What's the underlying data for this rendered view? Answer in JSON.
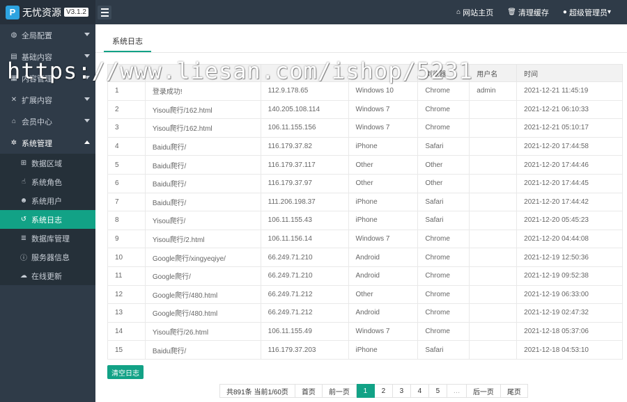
{
  "header": {
    "logo_mark": "P",
    "app_title": "无忧资源",
    "version": "V3.1.2",
    "links": [
      {
        "icon": "home-icon",
        "glyph": "⌂",
        "label": "网站主页"
      },
      {
        "icon": "trash-icon",
        "glyph": "🗑",
        "label": "清理缓存"
      },
      {
        "icon": "user-icon",
        "glyph": "●",
        "label": "超级管理员"
      }
    ],
    "user_caret": "▾"
  },
  "sidebar": {
    "items": [
      {
        "icon": "globe-icon",
        "glyph": "◍",
        "label": "全局配置"
      },
      {
        "icon": "folder-icon",
        "glyph": "▤",
        "label": "基础内容"
      },
      {
        "icon": "content-icon",
        "glyph": "▦",
        "label": "内容管理"
      },
      {
        "icon": "expand-icon",
        "glyph": "✕",
        "label": "扩展内容"
      },
      {
        "icon": "lock-icon",
        "glyph": "⌂",
        "label": "会员中心"
      },
      {
        "icon": "gear-icon",
        "glyph": "✲",
        "label": "系统管理"
      }
    ],
    "sub_items": [
      {
        "icon": "sitemap-icon",
        "glyph": "⊞",
        "label": "数据区域"
      },
      {
        "icon": "hand-icon",
        "glyph": "☝",
        "label": "系统角色"
      },
      {
        "icon": "users-icon",
        "glyph": "☻",
        "label": "系统用户"
      },
      {
        "icon": "history-icon",
        "glyph": "↺",
        "label": "系统日志"
      },
      {
        "icon": "database-icon",
        "glyph": "≣",
        "label": "数据库管理"
      },
      {
        "icon": "info-icon",
        "glyph": "ⓘ",
        "label": "服务器信息"
      },
      {
        "icon": "cloud-upload-icon",
        "glyph": "☁",
        "label": "在线更新"
      }
    ]
  },
  "main": {
    "tab": "系统日志",
    "watermark": "https://www.liesan.com/ishop/5231",
    "columns": [
      "",
      "",
      "",
      "",
      "浏览器",
      "用户名",
      "时间"
    ],
    "rows": [
      [
        "1",
        "登录成功!",
        "112.9.178.65",
        "Windows 10",
        "Chrome",
        "admin",
        "2021-12-21 11:45:19"
      ],
      [
        "2",
        "Yisou爬行/162.html",
        "140.205.108.114",
        "Windows 7",
        "Chrome",
        "",
        "2021-12-21 06:10:33"
      ],
      [
        "3",
        "Yisou爬行/162.html",
        "106.11.155.156",
        "Windows 7",
        "Chrome",
        "",
        "2021-12-21 05:10:17"
      ],
      [
        "4",
        "Baidu爬行/",
        "116.179.37.82",
        "iPhone",
        "Safari",
        "",
        "2021-12-20 17:44:58"
      ],
      [
        "5",
        "Baidu爬行/",
        "116.179.37.117",
        "Other",
        "Other",
        "",
        "2021-12-20 17:44:46"
      ],
      [
        "6",
        "Baidu爬行/",
        "116.179.37.97",
        "Other",
        "Other",
        "",
        "2021-12-20 17:44:45"
      ],
      [
        "7",
        "Baidu爬行/",
        "111.206.198.37",
        "iPhone",
        "Safari",
        "",
        "2021-12-20 17:44:42"
      ],
      [
        "8",
        "Yisou爬行/",
        "106.11.155.43",
        "iPhone",
        "Safari",
        "",
        "2021-12-20 05:45:23"
      ],
      [
        "9",
        "Yisou爬行/2.html",
        "106.11.156.14",
        "Windows 7",
        "Chrome",
        "",
        "2021-12-20 04:44:08"
      ],
      [
        "10",
        "Google爬行/xingyeqiye/",
        "66.249.71.210",
        "Android",
        "Chrome",
        "",
        "2021-12-19 12:50:36"
      ],
      [
        "11",
        "Google爬行/",
        "66.249.71.210",
        "Android",
        "Chrome",
        "",
        "2021-12-19 09:52:38"
      ],
      [
        "12",
        "Google爬行/480.html",
        "66.249.71.212",
        "Other",
        "Chrome",
        "",
        "2021-12-19 06:33:00"
      ],
      [
        "13",
        "Google爬行/480.html",
        "66.249.71.212",
        "Android",
        "Chrome",
        "",
        "2021-12-19 02:47:32"
      ],
      [
        "14",
        "Yisou爬行/26.html",
        "106.11.155.49",
        "Windows 7",
        "Chrome",
        "",
        "2021-12-18 05:37:06"
      ],
      [
        "15",
        "Baidu爬行/",
        "116.179.37.203",
        "iPhone",
        "Safari",
        "",
        "2021-12-18 04:53:10"
      ]
    ],
    "clear_button": "清空日志",
    "pagination": {
      "summary": "共891条 当前1/60页",
      "first": "首页",
      "prev": "前一页",
      "pages": [
        "1",
        "2",
        "3",
        "4",
        "5"
      ],
      "current": "1",
      "ellipsis": "…",
      "next": "后一页",
      "last": "尾页"
    }
  },
  "colors": {
    "accent": "#12a286",
    "sidebar": "#2f3b48",
    "topbar": "#2f3b48"
  }
}
